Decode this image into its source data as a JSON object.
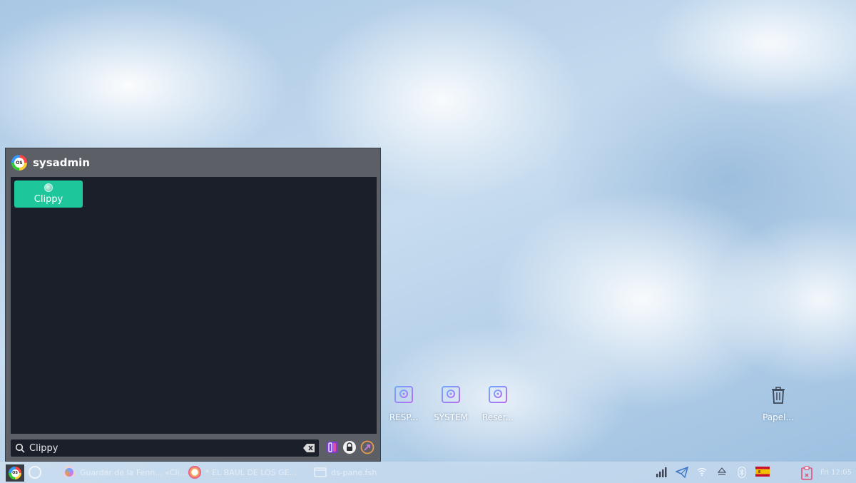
{
  "launcher": {
    "title": "sysadmin",
    "results": [
      {
        "label": "Clippy"
      }
    ],
    "search": {
      "value": "Clippy",
      "placeholder": ""
    }
  },
  "desktop": {
    "icons": [
      {
        "label": "RESP...",
        "icon": "drive-icon"
      },
      {
        "label": "SYSTEM",
        "icon": "drive-icon"
      },
      {
        "label": "Reser...",
        "icon": "drive-icon"
      },
      {
        "label": "Papel...",
        "icon": "trash-icon"
      }
    ]
  },
  "taskbar": {
    "tasks": [
      {
        "label": "Guardar de la Fenn... «Cli...",
        "icon": "browser-icon"
      },
      {
        "label": "* EL BAUL DE LOS GE...",
        "icon": "app-icon"
      },
      {
        "label": "ds-pane.fsh",
        "icon": "window-icon"
      }
    ],
    "tray": {
      "keyboard_flag": "Spanish",
      "clock": "Fri 12:05"
    }
  },
  "colors": {
    "accent": "#1ec79b",
    "launcher_bg": "#5c5f66",
    "panel_bg": "#1b1f2a",
    "icon_purple": "#8d6ef0"
  }
}
